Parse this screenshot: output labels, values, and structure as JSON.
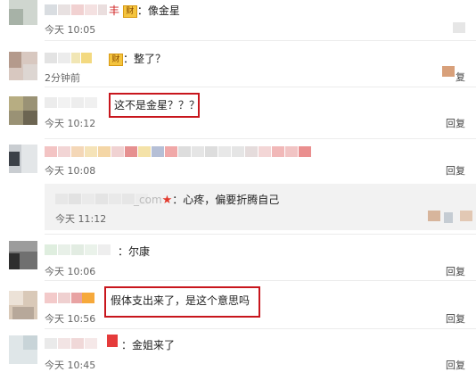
{
  "comments": [
    {
      "name_suffix": "丰",
      "badge": "财",
      "text": "：像金星",
      "time": "今天 10:05",
      "reply": ""
    },
    {
      "name_suffix": "",
      "badge": "财",
      "text": "：整了？",
      "time": "2分钟前",
      "reply": "复"
    },
    {
      "name_suffix": "",
      "badge": "",
      "text": "这不是金星？？？",
      "time": "今天 10:12",
      "reply": "回复"
    },
    {
      "name_suffix": "",
      "badge": "",
      "text": "",
      "time": "今天 10:08",
      "reply": "回复"
    },
    {
      "name_suffix": "_com",
      "badge": "",
      "text": "：心疼，偏要折腾自己",
      "time": "今天 11:12",
      "reply": ""
    },
    {
      "name_suffix": "",
      "badge": "",
      "text": "：尔康",
      "time": "今天 10:06",
      "reply": "回复"
    },
    {
      "name_suffix": "",
      "badge": "",
      "text": "假体支出来了，是这个意思吗",
      "time": "今天 10:56",
      "reply": "回复"
    },
    {
      "name_suffix": "",
      "badge": "",
      "text": "：金姐来了",
      "time": "今天 10:45",
      "reply": "回复"
    }
  ],
  "icons": {
    "coin": "coin-icon",
    "star": "star-icon",
    "thumb": "thumb-up-icon"
  },
  "colors": {
    "highlight": "#c8161d",
    "badge": "#f4c43e",
    "star": "#e2382b"
  }
}
